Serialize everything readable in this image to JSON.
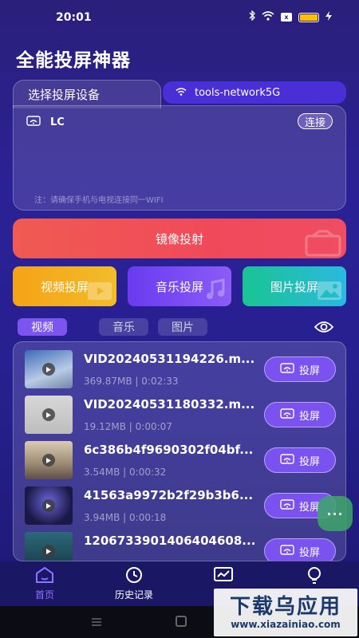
{
  "status_bar": {
    "time": "20:01",
    "sim_label": "x"
  },
  "app": {
    "title": "全能投屏神器"
  },
  "device_section": {
    "tab_label": "选择投屏设备",
    "network_name": "tools-network5G",
    "device_name": "LC",
    "connect_label": "连接",
    "hint": "注：请确保手机与电视连接同一WIFI"
  },
  "mirror": {
    "label": "镜像投射"
  },
  "categories": [
    {
      "label": "视频投屏",
      "color": "#f4a316"
    },
    {
      "label": "音乐投屏",
      "color": "#7a4cf2"
    },
    {
      "label": "图片投屏",
      "color": "#1fc0a8"
    }
  ],
  "filter_tabs": [
    {
      "label": "视频",
      "active": true
    },
    {
      "label": "音乐",
      "active": false
    },
    {
      "label": "图片",
      "active": false
    }
  ],
  "files": [
    {
      "title": "VID20240531194226.m...",
      "size": "369.87MB",
      "duration": "0:02:33",
      "cast_label": "投屏"
    },
    {
      "title": "VID20240531180332.m...",
      "size": "19.12MB",
      "duration": "0:00:07",
      "cast_label": "投屏"
    },
    {
      "title": "6c386b4f9690302f04bf...",
      "size": "3.54MB",
      "duration": "0:00:32",
      "cast_label": "投屏"
    },
    {
      "title": "41563a9972b2f29b3b6...",
      "size": "3.94MB",
      "duration": "0:00:18",
      "cast_label": "投屏"
    },
    {
      "title": "1206733901406404608...",
      "size": "",
      "duration": "",
      "cast_label": "投屏"
    }
  ],
  "meta_separator": "|",
  "float_button": {
    "label": "···"
  },
  "bottom_nav": [
    {
      "label": "首页",
      "active": true
    },
    {
      "label": "历史记录",
      "active": false
    },
    {
      "label": "",
      "active": false
    },
    {
      "label": "",
      "active": false
    }
  ],
  "watermark": {
    "main": "下载乌应用",
    "sub": "www.xiazainiao.com"
  },
  "colors": {
    "accent": "#7a52f0",
    "background": "#2b2196",
    "mirror": "#f04a5a"
  }
}
